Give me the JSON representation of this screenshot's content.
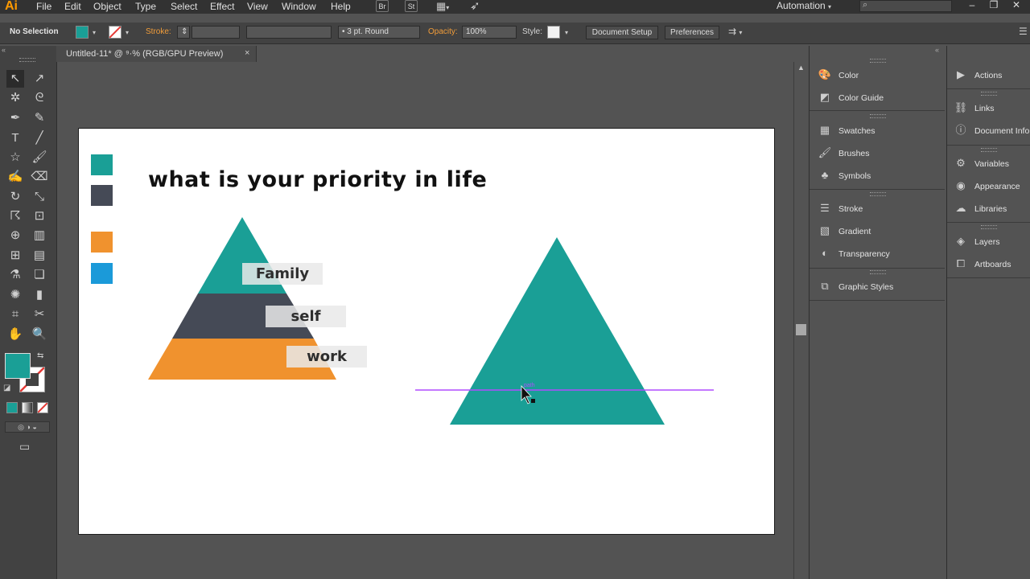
{
  "menubar": {
    "logo": "Ai",
    "items": [
      "File",
      "Edit",
      "Object",
      "Type",
      "Select",
      "Effect",
      "View",
      "Window",
      "Help"
    ],
    "bridge": "Br",
    "stock": "St",
    "workspace": "Automation"
  },
  "control": {
    "selection": "No Selection",
    "fill_color": "#1a9f96",
    "stroke_label": "Stroke:",
    "brush": "3 pt. Round",
    "opacity_label": "Opacity:",
    "opacity": "100%",
    "style_label": "Style:",
    "document_setup": "Document Setup",
    "preferences": "Preferences"
  },
  "document_tab": {
    "title": "Untitled-11* @ ⁹·% (RGB/GPU Preview)",
    "close": "×"
  },
  "artwork": {
    "title": "what is your priority in life",
    "labels": [
      "Family",
      "self",
      "work"
    ],
    "colors": {
      "teal": "#1a9f96",
      "slate": "#454a56",
      "orange": "#f0922e",
      "blue": "#1b9ad9"
    },
    "guide_color": "#b14bff"
  },
  "panel1": [
    "Color",
    "Color Guide",
    "Swatches",
    "Brushes",
    "Symbols",
    "Stroke",
    "Gradient",
    "Transparency",
    "Graphic Styles"
  ],
  "panel2": [
    "Actions",
    "Links",
    "Document Info",
    "Variables",
    "Appearance",
    "Libraries",
    "Layers",
    "Artboards"
  ]
}
